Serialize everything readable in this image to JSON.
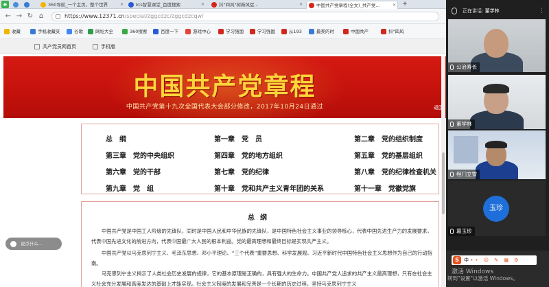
{
  "browser": {
    "tabs": [
      {
        "label": "360导航_一个主页，整个世界"
      },
      {
        "label": "kts智慧课堂_百度搜索"
      },
      {
        "label": "抖\"四风\"树新风促..."
      },
      {
        "label": "中国共产党章程(全文)_共产党..."
      }
    ],
    "url": {
      "domain": "https://www.12371.cn",
      "path": "/special/zggcdzc/zggcdzcqw/"
    },
    "bookmarks": [
      "收藏",
      "手机收藏夹",
      "谷歌",
      "网址大全",
      "360搜索",
      "百度一下",
      "游戏中心",
      "学习强国",
      "学习强国",
      "从193",
      "最美的时",
      "中国共产",
      "抖\"四风"
    ],
    "subnav": {
      "left": "共产党员网首页",
      "right": "手机版"
    }
  },
  "banner": {
    "title": "中国共产党章程",
    "subtitle": "中国共产党第十九次全国代表大会部分修改，2017年10月24日通过",
    "return_label": "返回"
  },
  "toc": [
    [
      "总　纲",
      "第一章　党　员",
      "第二章　党的组织制度"
    ],
    [
      "第三章　党的中央组织",
      "第四章　党的地方组织",
      "第五章　党的基层组织"
    ],
    [
      "第六章　党的干部",
      "第七章　党的纪律",
      "第八章　党的纪律检查机关"
    ],
    [
      "第九章　党　组",
      "第十章　党和共产主义青年团的关系",
      "第十一章　党徽党旗"
    ]
  ],
  "content": {
    "heading": "总纲",
    "paragraphs": [
      "中国共产党是中国工人阶级的先锋队，同时是中国人民和中华民族的先锋队，是中国特色社会主义事业的领导核心，代表中国先进生产力的发展要求，代表中国先进文化的前进方向，代表中国最广大人民的根本利益。党的最高理想和最终目标是实现共产主义。",
      "中国共产党以马克思列宁主义、毛泽东思想、邓小平理论、“三个代表”重要思想、科学发展观、习近平新时代中国特色社会主义思想作为自己的行动指南。",
      "马克思列宁主义揭示了人类社会历史发展的规律，它的基本原理是正确的，具有强大的生命力。中国共产党人追求的共产主义最高理想，只有在社会主义社会充分发展和高度发达的基础上才能实现。社会主义制度的发展和完善是一个长期的历史过程。坚持马克思列宁主义"
    ]
  },
  "voice_tip": "说点什么...",
  "meeting": {
    "speaker_prefix": "正在讲话:",
    "speaker_name": "董学林",
    "participants": [
      {
        "name": "公治寿长"
      },
      {
        "name": "董学林"
      },
      {
        "name": "程门立雪"
      },
      {
        "name": "葛玉珍",
        "avatar_text": "玉珍"
      }
    ]
  },
  "system": {
    "ime_label": "中",
    "ime_icons": "•• ☺ ✎ ▦ ⚙",
    "activate_line1": "激活 Windows",
    "activate_line2": "转到\"设置\"以激活 Windows。"
  },
  "colors": {
    "banner_red": "#c4110c",
    "banner_gold": "#ffd43a",
    "toc_border": "#e1a29a",
    "avatar_blue": "#1e6fd9"
  }
}
